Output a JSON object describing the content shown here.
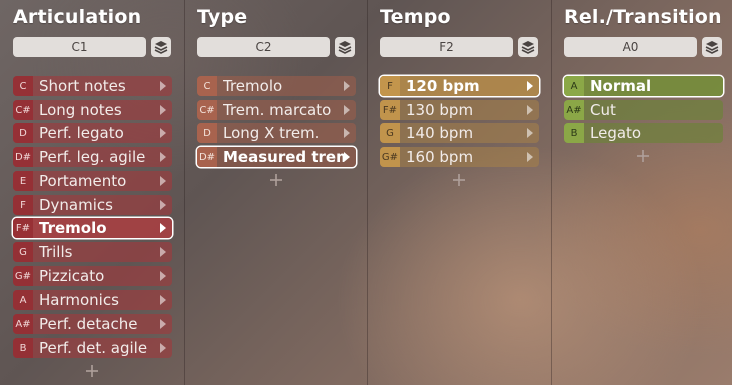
{
  "columns": [
    {
      "title": "Articulation",
      "key": "C1",
      "color": "#a03a3e",
      "items": [
        {
          "key": "C",
          "label": "Short notes",
          "selected": false
        },
        {
          "key": "C#",
          "label": "Long notes",
          "selected": false
        },
        {
          "key": "D",
          "label": "Perf. legato",
          "selected": false
        },
        {
          "key": "D#",
          "label": "Perf. leg. agile",
          "selected": false
        },
        {
          "key": "E",
          "label": "Portamento",
          "selected": false
        },
        {
          "key": "F",
          "label": "Dynamics",
          "selected": false
        },
        {
          "key": "F#",
          "label": "Tremolo",
          "selected": true
        },
        {
          "key": "G",
          "label": "Trills",
          "selected": false
        },
        {
          "key": "G#",
          "label": "Pizzicato",
          "selected": false
        },
        {
          "key": "A",
          "label": "Harmonics",
          "selected": false
        },
        {
          "key": "A#",
          "label": "Perf. detache",
          "selected": false
        },
        {
          "key": "B",
          "label": "Perf. det. agile",
          "selected": false
        }
      ]
    },
    {
      "title": "Type",
      "key": "C2",
      "color": "#a05f4b",
      "items": [
        {
          "key": "C",
          "label": "Tremolo",
          "selected": false
        },
        {
          "key": "C#",
          "label": "Trem. marcato",
          "selected": false
        },
        {
          "key": "D",
          "label": "Long X trem.",
          "selected": false
        },
        {
          "key": "D#",
          "label": "Measured trem",
          "selected": true
        }
      ]
    },
    {
      "title": "Tempo",
      "key": "F2",
      "color": "#c4964c",
      "items": [
        {
          "key": "F",
          "label": "120 bpm",
          "selected": true
        },
        {
          "key": "F#",
          "label": "130 bpm",
          "selected": false
        },
        {
          "key": "G",
          "label": "140 bpm",
          "selected": false
        },
        {
          "key": "G#",
          "label": "160 bpm",
          "selected": false
        }
      ]
    },
    {
      "title": "Rel./Transition",
      "key": "A0",
      "color": "#8caa48",
      "items": [
        {
          "key": "A",
          "label": "Normal",
          "selected": true
        },
        {
          "key": "A#",
          "label": "Cut",
          "selected": false
        },
        {
          "key": "B",
          "label": "Legato",
          "selected": false
        }
      ]
    }
  ],
  "icons": {
    "stack": "layers-icon",
    "add": "plus-icon",
    "arrow": "chevron-right-icon"
  }
}
